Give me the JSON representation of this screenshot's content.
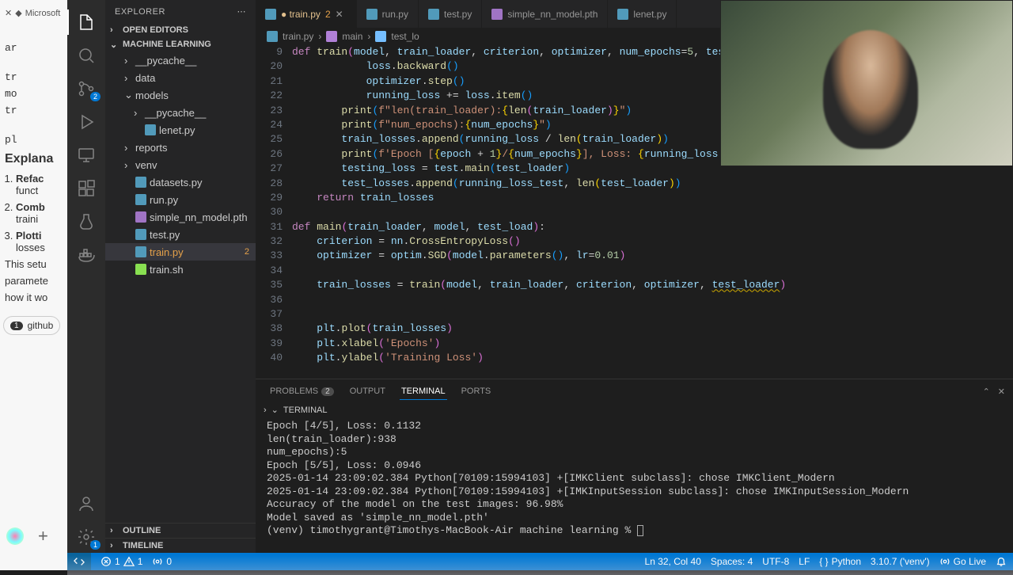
{
  "behind": {
    "tab_label": "Microsoft",
    "snips": [
      "ar",
      "tr",
      "mo",
      "tr",
      "pl"
    ],
    "heading": "Explana",
    "list": [
      {
        "b": "Refac",
        "r": "funct"
      },
      {
        "b": "Comb",
        "r": "traini"
      },
      {
        "b": "Plotti",
        "r": "losses"
      }
    ],
    "para": [
      "This setu",
      "paramete",
      "how it wo"
    ],
    "chip": {
      "n": "1",
      "t": "github"
    }
  },
  "explorer": {
    "title": "EXPLORER",
    "open_editors": "OPEN EDITORS",
    "project": "MACHINE LEARNING",
    "tree": [
      {
        "type": "folder",
        "depth": 0,
        "name": "__pycache__",
        "open": false
      },
      {
        "type": "folder",
        "depth": 0,
        "name": "data",
        "open": false
      },
      {
        "type": "folder",
        "depth": 0,
        "name": "models",
        "open": true
      },
      {
        "type": "folder",
        "depth": 1,
        "name": "__pycache__",
        "open": false
      },
      {
        "type": "file",
        "depth": 1,
        "name": "lenet.py",
        "color": "#519aba"
      },
      {
        "type": "folder",
        "depth": 0,
        "name": "reports",
        "open": false
      },
      {
        "type": "folder",
        "depth": 0,
        "name": "venv",
        "open": false
      },
      {
        "type": "file",
        "depth": 0,
        "name": "datasets.py",
        "color": "#519aba"
      },
      {
        "type": "file",
        "depth": 0,
        "name": "run.py",
        "color": "#519aba"
      },
      {
        "type": "file",
        "depth": 0,
        "name": "simple_nn_model.pth",
        "color": "#a074c4"
      },
      {
        "type": "file",
        "depth": 0,
        "name": "test.py",
        "color": "#519aba"
      },
      {
        "type": "file",
        "depth": 0,
        "name": "train.py",
        "color": "#519aba",
        "sel": true,
        "warn": true,
        "num": "2"
      },
      {
        "type": "file",
        "depth": 0,
        "name": "train.sh",
        "color": "#89e051"
      }
    ],
    "outline": "OUTLINE",
    "timeline": "TIMELINE"
  },
  "tabs": [
    {
      "name": "train.py",
      "mod": true,
      "active": true,
      "count": "2",
      "icon": "#519aba"
    },
    {
      "name": "run.py",
      "icon": "#519aba"
    },
    {
      "name": "test.py",
      "icon": "#519aba"
    },
    {
      "name": "simple_nn_model.pth",
      "icon": "#a074c4"
    },
    {
      "name": "lenet.py",
      "icon": "#519aba"
    }
  ],
  "breadcrumb": {
    "file": "train.py",
    "fn": "main",
    "sym": "test_lo"
  },
  "code": {
    "start": 9,
    "lines": [
      "<span class='k'>def</span> <span class='fn'>train</span><span class='pa'>(</span><span class='va'>model</span>, <span class='va'>train_loader</span>, <span class='va'>criterion</span>, <span class='va'>optimizer</span>, <span class='va'>num_epochs</span>=<span class='n'>5</span>, <span class='va'>test_loade</span>",
      "            <span class='va'>loss</span>.<span class='fn'>backward</span><span class='pb'>(</span><span class='pb'>)</span>",
      "            <span class='va'>optimizer</span>.<span class='fn'>step</span><span class='pb'>(</span><span class='pb'>)</span>",
      "            <span class='va'>running_loss</span> += <span class='va'>loss</span>.<span class='fn'>item</span><span class='pb'>(</span><span class='pb'>)</span>",
      "        <span class='fn'>print</span><span class='pb'>(</span><span class='s'>f\"len(train_loader):</span><span class='pc'>{</span><span class='fn'>len</span><span class='pa'>(</span><span class='va'>train_loader</span><span class='pa'>)</span><span class='pc'>}</span><span class='s'>\"</span><span class='pb'>)</span>",
      "        <span class='fn'>print</span><span class='pb'>(</span><span class='s'>f\"num_epochs):</span><span class='pc'>{</span><span class='va'>num_epochs</span><span class='pc'>}</span><span class='s'>\"</span><span class='pb'>)</span>",
      "        <span class='va'>train_losses</span>.<span class='fn'>append</span><span class='pb'>(</span><span class='va'>running_loss</span> / <span class='fn'>len</span><span class='pc'>(</span><span class='va'>train_loader</span><span class='pc'>)</span><span class='pb'>)</span>",
      "        <span class='fn'>print</span><span class='pb'>(</span><span class='s'>f'Epoch [</span><span class='pc'>{</span><span class='va'>epoch</span> + <span class='n'>1</span><span class='pc'>}</span><span class='s'>/</span><span class='pc'>{</span><span class='va'>num_epochs</span><span class='pc'>}</span><span class='s'>], Loss: </span><span class='pc'>{</span><span class='va'>running_loss</span> / <span class='fn'>len</span><span class='pa'>(</span><span class='va'>train_loader</span><span class='pa'>)</span><span class='s'>:</span><span class='n'>.4f</span><span class='pc'>}</span><span class='s'>'</span><span class='pb'>)</span>",
      "        <span class='va'>testing_loss</span> = <span class='va'>test</span>.<span class='fn'>main</span><span class='pb'>(</span><span class='va'>test_loader</span><span class='pb'>)</span>",
      "        <span class='va'>test_losses</span>.<span class='fn'>append</span><span class='pb'>(</span><span class='va'>running_loss_test</span>, <span class='fn'>len</span><span class='pc'>(</span><span class='va'>test_loader</span><span class='pc'>)</span><span class='pb'>)</span>",
      "    <span class='k'>return</span> <span class='va'>train_losses</span>",
      "",
      "<span class='k'>def</span> <span class='fn'>main</span><span class='pa'>(</span><span class='va'>train_loader</span>, <span class='va'>model</span>, <span class='va'>test_load</span><span class='pa'>)</span>:",
      "    <span class='va'>criterion</span> = <span class='va'>nn</span>.<span class='fn'>CrossEntropyLoss</span><span class='pa'>(</span><span class='pa'>)</span>",
      "    <span class='va'>optimizer</span> = <span class='va'>optim</span>.<span class='fn'>SGD</span><span class='pa'>(</span><span class='va'>model</span>.<span class='fn'>parameters</span><span class='pb'>(</span><span class='pb'>)</span>, <span class='va'>lr</span>=<span class='n'>0.01</span><span class='pa'>)</span>",
      "",
      "    <span class='va'>train_losses</span> = <span class='fn'>train</span><span class='pa'>(</span><span class='va'>model</span>, <span class='va'>train_loader</span>, <span class='va'>criterion</span>, <span class='va'>optimizer</span>, <span class='va squig'>test_loader</span><span class='pa'>)</span>",
      "",
      "",
      "    <span class='va'>plt</span>.<span class='fn'>plot</span><span class='pa'>(</span><span class='va'>train_losses</span><span class='pa'>)</span>",
      "    <span class='va'>plt</span>.<span class='fn'>xlabel</span><span class='pa'>(</span><span class='s'>'Epochs'</span><span class='pa'>)</span>",
      "    <span class='va'>plt</span>.<span class='fn'>ylabel</span><span class='pa'>(</span><span class='s'>'Training Loss'</span><span class='pa'>)</span>"
    ]
  },
  "panel": {
    "tabs": {
      "problems": "PROBLEMS",
      "problems_n": "2",
      "output": "OUTPUT",
      "terminal": "TERMINAL",
      "ports": "PORTS"
    },
    "term_label": "TERMINAL",
    "lines": [
      "Epoch [4/5], Loss: 0.1132",
      "len(train_loader):938",
      "num_epochs):5",
      "Epoch [5/5], Loss: 0.0946",
      "2025-01-14 23:09:02.384 Python[70109:15994103] +[IMKClient subclass]: chose IMKClient_Modern",
      "2025-01-14 23:09:02.384 Python[70109:15994103] +[IMKInputSession subclass]: chose IMKInputSession_Modern",
      "Accuracy of the model on the test images: 96.98%",
      "Model saved as 'simple_nn_model.pth'",
      "(venv) timothygrant@Timothys-MacBook-Air machine learning % "
    ]
  },
  "status": {
    "err": "1",
    "warn": "1",
    "ports": "0",
    "lncol": "Ln 32, Col 40",
    "spaces": "Spaces: 4",
    "enc": "UTF-8",
    "eol": "LF",
    "lang": "Python",
    "interp": "3.10.7 ('venv')",
    "live": "Go Live"
  },
  "activity_badges": {
    "scm": "2",
    "ext": "1"
  }
}
